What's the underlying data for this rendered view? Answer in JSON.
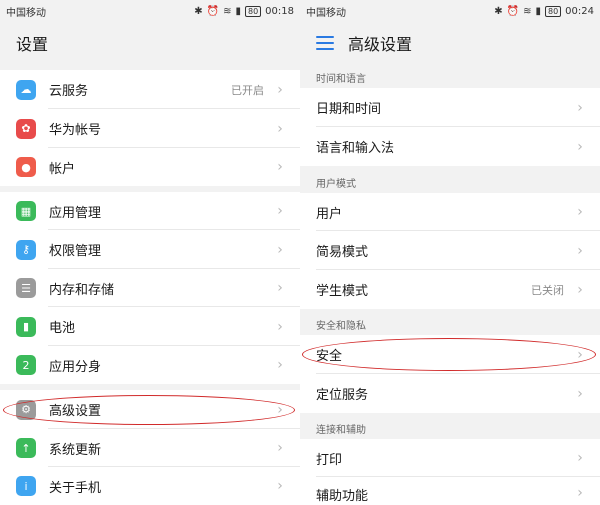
{
  "left": {
    "status": {
      "carrier": "中国移动",
      "battery": "80",
      "time": "00:18"
    },
    "title": "设置",
    "items": [
      {
        "label": "云服务",
        "value": "已开启",
        "icon": "cloud-icon",
        "color": "#3fa5f0"
      },
      {
        "label": "华为帐号",
        "value": "",
        "icon": "huawei-icon",
        "color": "#e84b4b"
      },
      {
        "label": "帐户",
        "value": "",
        "icon": "account-icon",
        "color": "#ef5c4b"
      },
      {
        "label": "应用管理",
        "value": "",
        "icon": "apps-icon",
        "color": "#3bba5a"
      },
      {
        "label": "权限管理",
        "value": "",
        "icon": "key-icon",
        "color": "#3fa5f0"
      },
      {
        "label": "内存和存储",
        "value": "",
        "icon": "storage-icon",
        "color": "#9b9b9b"
      },
      {
        "label": "电池",
        "value": "",
        "icon": "battery-icon",
        "color": "#3bba5a"
      },
      {
        "label": "应用分身",
        "value": "",
        "icon": "twin-app-icon",
        "color": "#3bba5a"
      },
      {
        "label": "高级设置",
        "value": "",
        "icon": "gear-icon",
        "color": "#9b9b9b"
      },
      {
        "label": "系统更新",
        "value": "",
        "icon": "update-icon",
        "color": "#3bba5a"
      },
      {
        "label": "关于手机",
        "value": "",
        "icon": "info-icon",
        "color": "#3fa5f0"
      }
    ]
  },
  "right": {
    "status": {
      "carrier": "中国移动",
      "battery": "80",
      "time": "00:24"
    },
    "title": "高级设置",
    "sections": [
      {
        "header": "时间和语言",
        "items": [
          {
            "label": "日期和时间",
            "value": ""
          },
          {
            "label": "语言和输入法",
            "value": ""
          }
        ]
      },
      {
        "header": "用户模式",
        "items": [
          {
            "label": "用户",
            "value": ""
          },
          {
            "label": "简易模式",
            "value": ""
          },
          {
            "label": "学生模式",
            "value": "已关闭"
          }
        ]
      },
      {
        "header": "安全和隐私",
        "items": [
          {
            "label": "安全",
            "value": ""
          },
          {
            "label": "定位服务",
            "value": ""
          }
        ]
      },
      {
        "header": "连接和辅助",
        "items": [
          {
            "label": "打印",
            "value": ""
          },
          {
            "label": "辅助功能",
            "value": ""
          }
        ]
      }
    ]
  },
  "colors": {
    "highlight": "#d12b2b",
    "accent": "#2a7ae2"
  }
}
